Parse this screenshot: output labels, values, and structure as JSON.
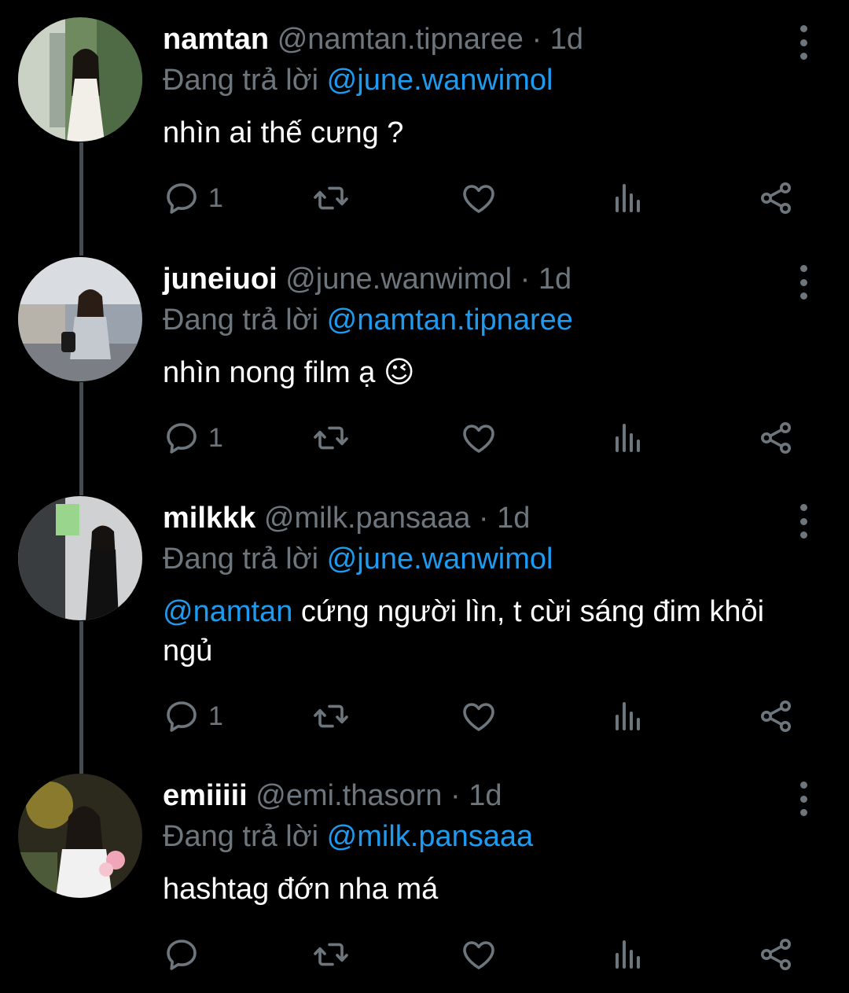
{
  "colors": {
    "background": "#000000",
    "name": "#ffffff",
    "secondary_text": "#6e767d",
    "mention": "#1d9bf0",
    "thread_line": "#444b51"
  },
  "tweets": [
    {
      "name": "namtan",
      "handle": "@namtan.tipnaree",
      "time": "1d",
      "reply_prefix": "Đang trả lời",
      "reply_to": "@june.wanwimol",
      "body_mention": "",
      "body": "nhìn ai thế cưng ?",
      "reply_count": "1",
      "icons": [
        "reply-icon",
        "retweet-icon",
        "like-icon",
        "analytics-icon",
        "share-icon",
        "more-icon"
      ]
    },
    {
      "name": "juneiuoi",
      "handle": "@june.wanwimol",
      "time": "1d",
      "reply_prefix": "Đang trả lời",
      "reply_to": "@namtan.tipnaree",
      "body_mention": "",
      "body": "nhìn nong film ạ 😉",
      "reply_count": "1",
      "icons": [
        "reply-icon",
        "retweet-icon",
        "like-icon",
        "analytics-icon",
        "share-icon",
        "more-icon"
      ]
    },
    {
      "name": "milkkk",
      "handle": "@milk.pansaaa",
      "time": "1d",
      "reply_prefix": "Đang trả lời",
      "reply_to": "@june.wanwimol",
      "body_mention": "@namtan",
      "body": " cứng người lìn, t cừi sáng đim khỏi ngủ",
      "reply_count": "1",
      "icons": [
        "reply-icon",
        "retweet-icon",
        "like-icon",
        "analytics-icon",
        "share-icon",
        "more-icon"
      ]
    },
    {
      "name": "emiiiii",
      "handle": "@emi.thasorn",
      "time": "1d",
      "reply_prefix": "Đang trả lời",
      "reply_to": "@milk.pansaaa",
      "body_mention": "",
      "body": "hashtag đớn nha má",
      "reply_count": "",
      "icons": [
        "reply-icon",
        "retweet-icon",
        "like-icon",
        "analytics-icon",
        "share-icon",
        "more-icon"
      ]
    }
  ]
}
